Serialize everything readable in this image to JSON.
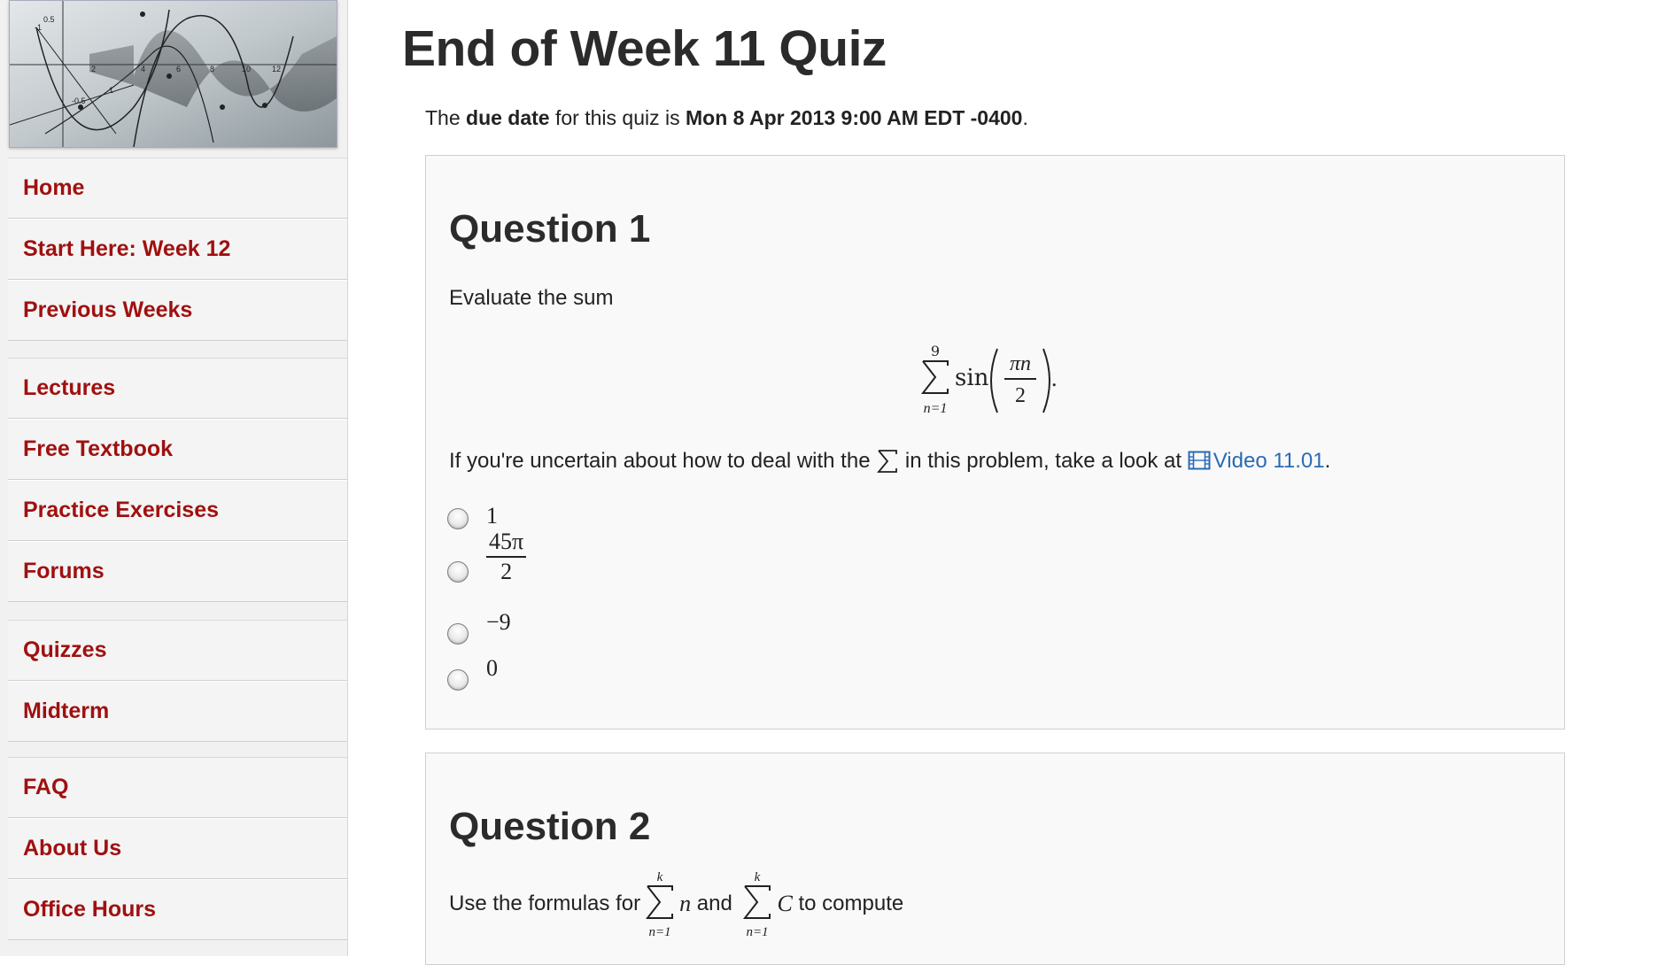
{
  "sidebar": {
    "groups": [
      [
        "Home",
        "Start Here: Week 12",
        "Previous Weeks"
      ],
      [
        "Lectures",
        "Free Textbook",
        "Practice Exercises",
        "Forums"
      ],
      [
        "Quizzes",
        "Midterm"
      ],
      [
        "FAQ",
        "About Us",
        "Office Hours"
      ]
    ],
    "banner_ticks": [
      "0.5",
      "-1",
      "-0.5",
      "1",
      "2",
      "4",
      "6",
      "8",
      "10",
      "12"
    ]
  },
  "page": {
    "title": "End of Week 11 Quiz",
    "due_prefix": "The ",
    "due_label": "due date",
    "due_middle": " for this quiz is ",
    "due_value": "Mon 8 Apr 2013 9:00 AM EDT -0400",
    "due_suffix": "."
  },
  "question1": {
    "heading": "Question 1",
    "prompt": "Evaluate the sum",
    "formula": {
      "upper": "9",
      "lower": "n=1",
      "func": "sin",
      "num": "πn",
      "den": "2",
      "end": "."
    },
    "hint_before": "If you're uncertain about how to deal with the ",
    "hint_middle": " in this problem, take a look at ",
    "hint_link": "Video 11.01",
    "hint_after": ".",
    "choices": [
      {
        "label": "1"
      },
      {
        "num": "45π",
        "den": "2"
      },
      {
        "label": "−9"
      },
      {
        "label": "0"
      }
    ]
  },
  "question2": {
    "heading": "Question 2",
    "prompt_before": "Use the formulas for ",
    "sum1_upper": "k",
    "sum1_lower": "n=1",
    "sum1_term": "n",
    "and": " and ",
    "sum2_upper": "k",
    "sum2_lower": "n=1",
    "sum2_term": "C",
    "prompt_after": " to compute"
  },
  "colors": {
    "nav_link": "#a01010",
    "link": "#2a6bb5"
  }
}
